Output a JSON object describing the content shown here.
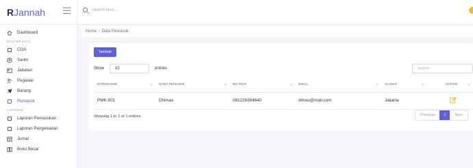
{
  "brand": {
    "first": "R",
    "rest": "Jannah"
  },
  "search": {
    "placeholder": "Search here..."
  },
  "sidebar": {
    "dashboard": "Dashboard",
    "master_heading": "MASTER DATA",
    "master_items": [
      "COA",
      "Santri",
      "Jabatan",
      "Pegawai",
      "Barang",
      "Pemasok"
    ],
    "report_heading": "LAPORAN",
    "report_items": [
      "Laporan Pemasukan",
      "Laporan Pengeluaran",
      "Jurnal",
      "Buku Besar"
    ]
  },
  "breadcrumb": {
    "home": "Home",
    "separator": "/",
    "current": "Data Pemasok"
  },
  "toolbar": {
    "add_label": "Tambah"
  },
  "length": {
    "show_label": "Show",
    "value": "10",
    "entries_label": "entries"
  },
  "filter": {
    "placeholder": "Search"
  },
  "table": {
    "columns": [
      "ID PEMASOK",
      "NAMA PEMASOK",
      "NO TELP",
      "EMAIL",
      "ALAMAT",
      "ACTION"
    ],
    "rows": [
      [
        "PMK-001",
        "Dhimas",
        "081226384640",
        "dimas@mail.com",
        "Jakarta"
      ]
    ]
  },
  "info": "Showing 1 to 1 of 1 entries",
  "pagination": {
    "previous": "Previous",
    "current": "1",
    "next": "Next"
  },
  "colors": {
    "accent": "#5b5fe6",
    "edit_icon": "#f5b82e",
    "user_avatar": "#f5b82e"
  }
}
